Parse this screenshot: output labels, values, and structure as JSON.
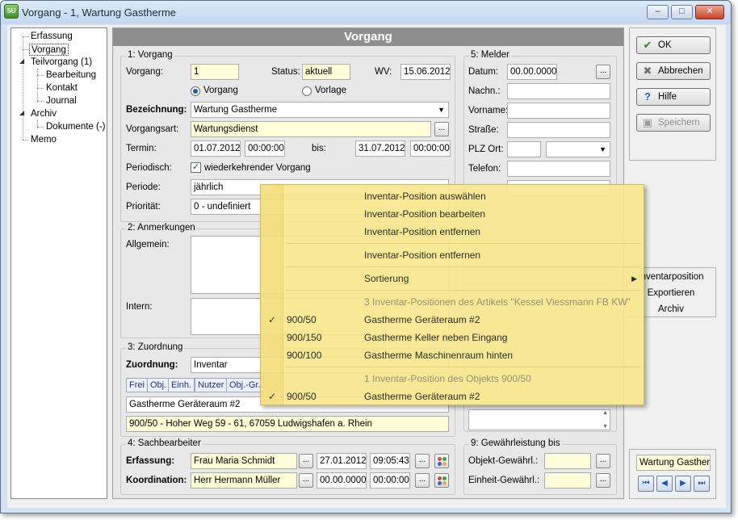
{
  "window": {
    "title": "Vorgang - 1, Wartung Gastherme",
    "icon_text": "SU"
  },
  "tree": [
    {
      "label": "Erfassung"
    },
    {
      "label": "Vorgang"
    },
    {
      "label": "Teilvorgang (1)"
    },
    {
      "label": "Bearbeitung"
    },
    {
      "label": "Kontakt"
    },
    {
      "label": "Journal"
    },
    {
      "label": "Archiv"
    },
    {
      "label": "Dokumente (-)"
    },
    {
      "label": "Memo"
    }
  ],
  "main": {
    "header": "Vorgang"
  },
  "vorgang": {
    "group": "1: Vorgang",
    "vorgang_label": "Vorgang:",
    "vorgang_value": "1",
    "status_label": "Status:",
    "status_value": "aktuell",
    "wv_label": "WV:",
    "wv_value": "15.06.2012",
    "radio_vorgang": "Vorgang",
    "radio_vorlage": "Vorlage",
    "bezeichnung_label": "Bezeichnung:",
    "bezeichnung_value": "Wartung Gastherme",
    "vorgangsart_label": "Vorgangsart:",
    "vorgangsart_value": "Wartungsdienst",
    "termin_label": "Termin:",
    "termin_date": "01.07.2012",
    "termin_time": "00:00:00",
    "bis_label": "bis:",
    "bis_date": "31.07.2012",
    "bis_time": "00:00:00",
    "periodisch_label": "Periodisch:",
    "periodisch_check": "wiederkehrender Vorgang",
    "periode_label": "Periode:",
    "periode_value": "jährlich",
    "prioritaet_label": "Priorität:",
    "prioritaet_value": "0 - undefiniert"
  },
  "anmerkungen": {
    "group": "2: Anmerkungen",
    "allgemein_label": "Allgemein:",
    "intern_label": "Intern:"
  },
  "zuordnung": {
    "group": "3: Zuordnung",
    "label": "Zuordnung:",
    "value": "Inventar",
    "tabs": [
      "Frei",
      "Obj.",
      "Einh.",
      "Nutzer",
      "Obj.-Gr."
    ],
    "position_value": "Gastherme Geräteraum #2",
    "address_value": "900/50 - Hoher Weg 59 - 61, 67059 Ludwigshafen a. Rhein"
  },
  "sachbearbeiter": {
    "group": "4: Sachbearbeiter",
    "erfassung_label": "Erfassung:",
    "erfassung_name": "Frau Maria Schmidt",
    "erfassung_date": "27.01.2012",
    "erfassung_time": "09:05:43",
    "koordination_label": "Koordination:",
    "koordination_name": "Herr Hermann Müller",
    "koordination_date": "00.00.0000",
    "koordination_time": "00:00:00"
  },
  "melder": {
    "group": "5: Melder",
    "datum_label": "Datum:",
    "datum_value": "00.00.0000",
    "nachname_label": "Nachn.:",
    "vorname_label": "Vorname:",
    "strasse_label": "Straße:",
    "plz_label": "PLZ Ort:",
    "telefon_label": "Telefon:"
  },
  "gewaehr": {
    "group": "9: Gewährleistung bis",
    "objekt_label": "Objekt-Gewährl.:",
    "einheit_label": "Einheit-Gewährl.:"
  },
  "buttons": {
    "ok": "OK",
    "abbrechen": "Abbrechen",
    "hilfe": "Hilfe",
    "speichern": "Speichern"
  },
  "sidebox": [
    "Inventarposition",
    "Exportieren",
    "Archiv"
  ],
  "navbox": {
    "current": "Wartung Gastherm"
  },
  "context_menu": {
    "items": [
      {
        "label": "Inventar-Position auswählen"
      },
      {
        "label": "Inventar-Position bearbeiten"
      },
      {
        "label": "Inventar-Position entfernen"
      },
      {
        "label": "Inventar-Position entfernen"
      },
      {
        "label": "Sortierung"
      },
      {
        "label": "3 Inventar-Positionen des Artikels \"Kessel Viessmann FB KW\""
      },
      {
        "code": "900/50",
        "label": "Gastherme Geräteraum #2"
      },
      {
        "code": "900/150",
        "label": "Gastherme Keller neben Eingang"
      },
      {
        "code": "900/100",
        "label": "Gastherme Maschinenraum hinten"
      },
      {
        "label": "1 Inventar-Position des Objekts 900/50"
      },
      {
        "code": "900/50",
        "label": "Gastherme Geräteraum #2"
      }
    ]
  }
}
